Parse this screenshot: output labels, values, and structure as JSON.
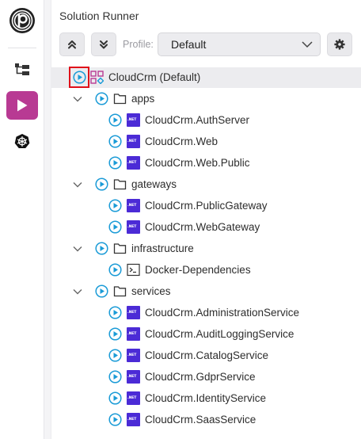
{
  "panel": {
    "title": "Solution Runner"
  },
  "toolbar": {
    "profile_label": "Profile:",
    "profile_value": "Default"
  },
  "tree": {
    "root": {
      "label": "CloudCrm (Default)"
    },
    "folders": [
      {
        "label": "apps",
        "items": [
          "CloudCrm.AuthServer",
          "CloudCrm.Web",
          "CloudCrm.Web.Public"
        ]
      },
      {
        "label": "gateways",
        "items": [
          "CloudCrm.PublicGateway",
          "CloudCrm.WebGateway"
        ]
      },
      {
        "label": "infrastructure",
        "items": [
          "Docker-Dependencies"
        ]
      },
      {
        "label": "services",
        "items": [
          "CloudCrm.AdministrationService",
          "CloudCrm.AuditLoggingService",
          "CloudCrm.CatalogService",
          "CloudCrm.GdprService",
          "CloudCrm.IdentityService",
          "CloudCrm.SaasService"
        ]
      }
    ],
    "net_badge": ".NET"
  },
  "colors": {
    "accent": "#b83a93",
    "run_icon": "#1a9bd7",
    "net_badge": "#4b2bd6",
    "highlight": "#e0101a"
  }
}
